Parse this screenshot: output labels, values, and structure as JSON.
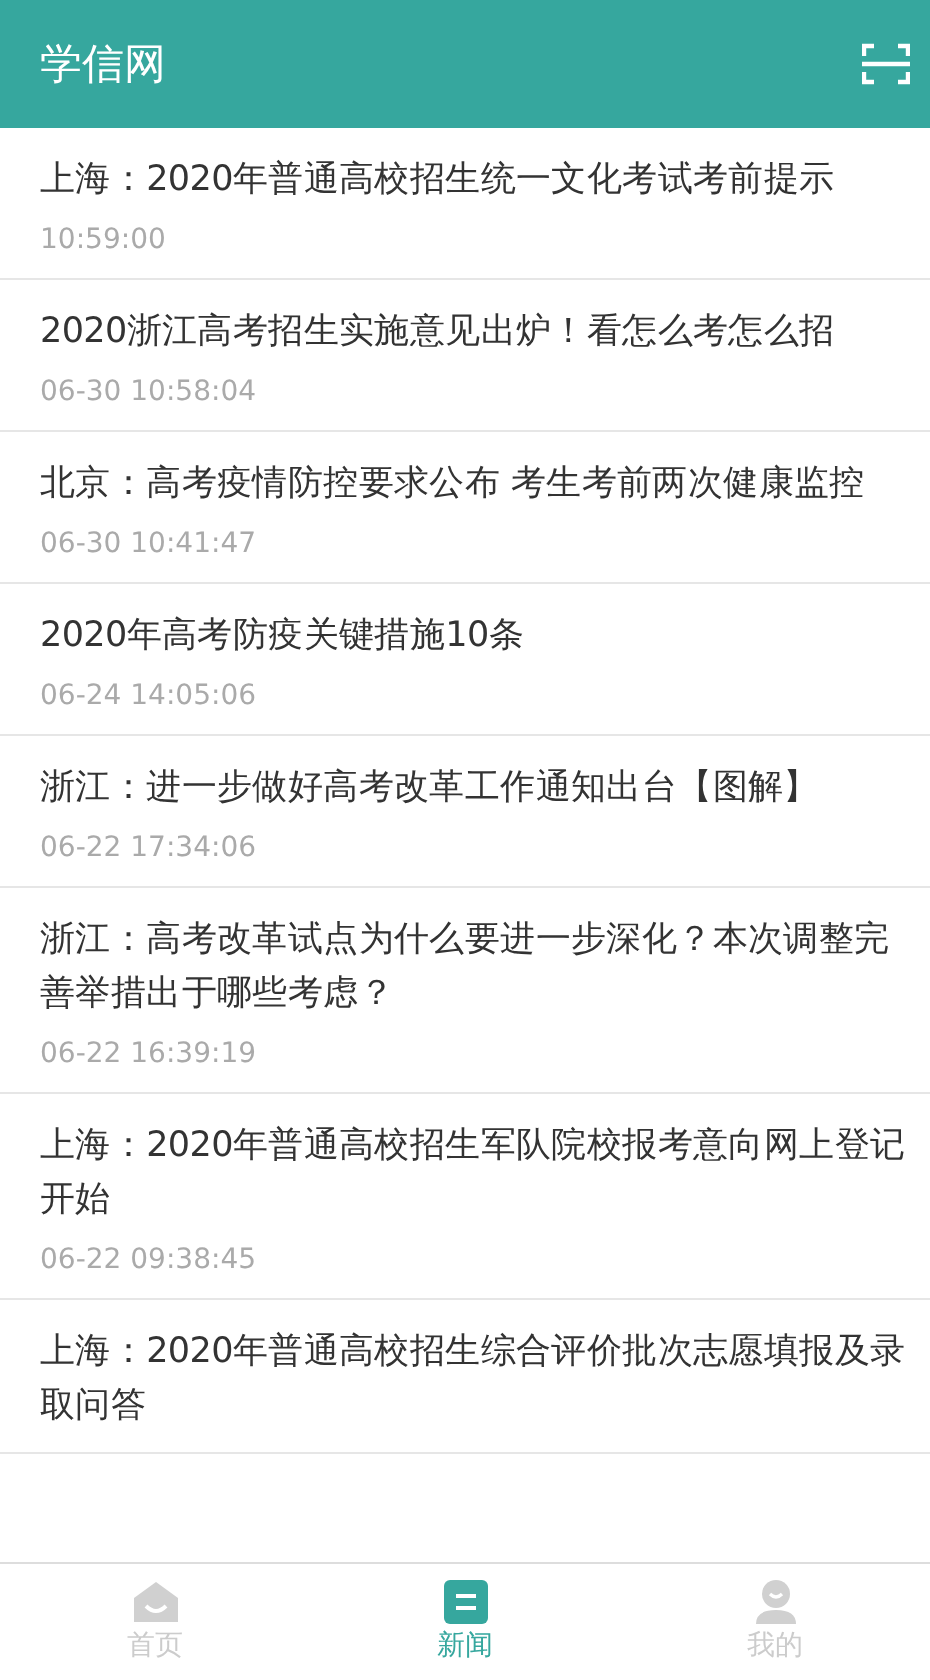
{
  "header": {
    "title": "学信网"
  },
  "news": [
    {
      "title": "上海：2020年普通高校招生统一文化考试考前提示",
      "time": "10:59:00"
    },
    {
      "title": "2020浙江高考招生实施意见出炉！看怎么考怎么招",
      "time": "06-30 10:58:04"
    },
    {
      "title": "北京：高考疫情防控要求公布  考生考前两次健康监控",
      "time": "06-30 10:41:47"
    },
    {
      "title": "2020年高考防疫关键措施10条",
      "time": "06-24 14:05:06"
    },
    {
      "title": "浙江：进一步做好高考改革工作通知出台【图解】",
      "time": "06-22 17:34:06"
    },
    {
      "title": "浙江：高考改革试点为什么要进一步深化？本次调整完善举措出于哪些考虑？",
      "time": "06-22 16:39:19"
    },
    {
      "title": "上海：2020年普通高校招生军队院校报考意向网上登记开始",
      "time": "06-22 09:38:45"
    },
    {
      "title": "上海：2020年普通高校招生综合评价批次志愿填报及录取问答"
    }
  ],
  "tabs": [
    {
      "kind": "home",
      "label": "首页",
      "selected": false
    },
    {
      "kind": "news",
      "label": "新闻",
      "selected": true
    },
    {
      "kind": "me",
      "label": "我的",
      "selected": false
    }
  ]
}
